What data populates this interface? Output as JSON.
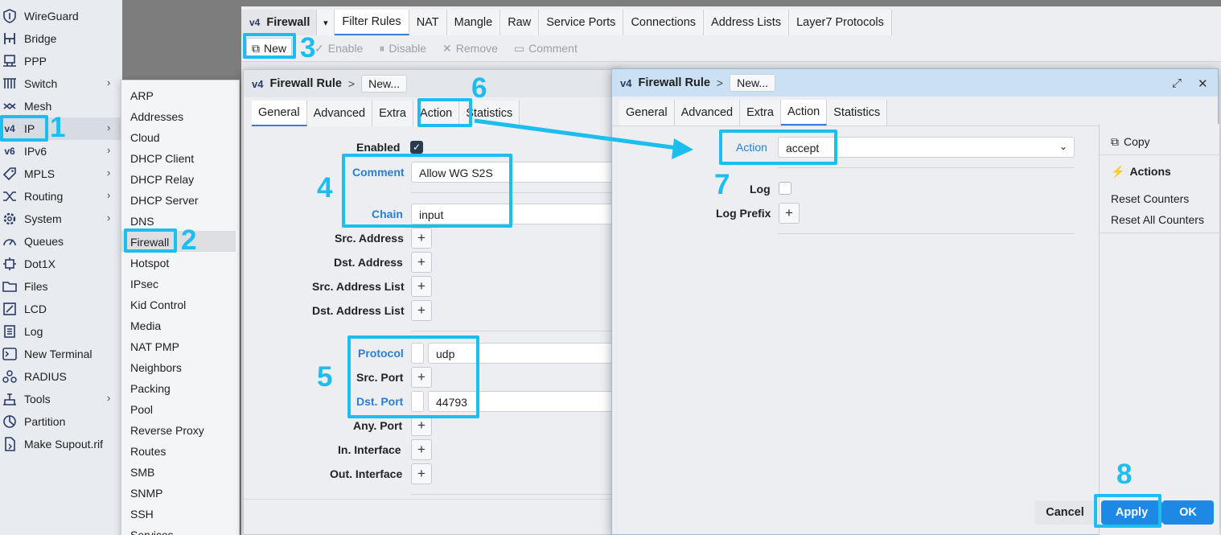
{
  "sidebar": {
    "items": [
      {
        "label": "WireGuard",
        "icon": "shield-icon",
        "chevron": false
      },
      {
        "label": "Bridge",
        "icon": "bridge-icon",
        "chevron": false
      },
      {
        "label": "PPP",
        "icon": "ppp-icon",
        "chevron": false
      },
      {
        "label": "Switch",
        "icon": "switch-icon",
        "chevron": true
      },
      {
        "label": "Mesh",
        "icon": "mesh-icon",
        "chevron": false
      },
      {
        "label": "IP",
        "icon": "ipv4-icon",
        "chevron": true
      },
      {
        "label": "IPv6",
        "icon": "ipv6-icon",
        "chevron": true
      },
      {
        "label": "MPLS",
        "icon": "tag-icon",
        "chevron": true
      },
      {
        "label": "Routing",
        "icon": "routing-icon",
        "chevron": true
      },
      {
        "label": "System",
        "icon": "gear-icon",
        "chevron": true
      },
      {
        "label": "Queues",
        "icon": "gauge-icon",
        "chevron": false
      },
      {
        "label": "Dot1X",
        "icon": "dot1x-icon",
        "chevron": false
      },
      {
        "label": "Files",
        "icon": "folder-icon",
        "chevron": false
      },
      {
        "label": "LCD",
        "icon": "lcd-icon",
        "chevron": false
      },
      {
        "label": "Log",
        "icon": "log-icon",
        "chevron": false
      },
      {
        "label": "New Terminal",
        "icon": "terminal-icon",
        "chevron": false
      },
      {
        "label": "RADIUS",
        "icon": "radius-icon",
        "chevron": false
      },
      {
        "label": "Tools",
        "icon": "tools-icon",
        "chevron": true
      },
      {
        "label": "Partition",
        "icon": "partition-icon",
        "chevron": false
      },
      {
        "label": "Make Supout.rif",
        "icon": "file-icon",
        "chevron": false
      }
    ]
  },
  "submenu": {
    "items": [
      "ARP",
      "Addresses",
      "Cloud",
      "DHCP Client",
      "DHCP Relay",
      "DHCP Server",
      "DNS",
      "Firewall",
      "Hotspot",
      "IPsec",
      "Kid Control",
      "Media",
      "NAT PMP",
      "Neighbors",
      "Packing",
      "Pool",
      "Reverse Proxy",
      "Routes",
      "SMB",
      "SNMP",
      "SSH",
      "Services"
    ]
  },
  "main": {
    "title": "Firewall",
    "title_icon": "v4",
    "tabs": [
      "Filter Rules",
      "NAT",
      "Mangle",
      "Raw",
      "Service Ports",
      "Connections",
      "Address Lists",
      "Layer7 Protocols"
    ],
    "toolbar": {
      "new_label": "New",
      "enable_label": "Enable",
      "disable_label": "Disable",
      "remove_label": "Remove",
      "comment_label": "Comment"
    }
  },
  "dialog_general": {
    "title": "Firewall Rule",
    "breadcrumb_sep": ">",
    "breadcrumb": "New...",
    "tabs": [
      "General",
      "Advanced",
      "Extra",
      "Action",
      "Statistics"
    ],
    "enabled_label": "Enabled",
    "comment_label": "Comment",
    "comment_value": "Allow WG S2S",
    "chain_label": "Chain",
    "chain_value": "input",
    "src_address_label": "Src. Address",
    "dst_address_label": "Dst. Address",
    "src_address_list_label": "Src. Address List",
    "dst_address_list_label": "Dst. Address List",
    "protocol_label": "Protocol",
    "protocol_value": "udp",
    "src_port_label": "Src. Port",
    "dst_port_label": "Dst. Port",
    "dst_port_value": "44793",
    "any_port_label": "Any. Port",
    "in_interface_label": "In. Interface",
    "out_interface_label": "Out. Interface",
    "plus": "+"
  },
  "dialog_action": {
    "title": "Firewall Rule",
    "breadcrumb_sep": ">",
    "breadcrumb": "New...",
    "tabs": [
      "General",
      "Advanced",
      "Extra",
      "Action",
      "Statistics"
    ],
    "action_label": "Action",
    "action_value": "accept",
    "log_label": "Log",
    "log_prefix_label": "Log Prefix",
    "plus": "+",
    "side": {
      "copy_label": "Copy",
      "actions_heading": "Actions",
      "reset_counters": "Reset Counters",
      "reset_all_counters": "Reset All Counters"
    },
    "cancel_label": "Cancel",
    "apply_label": "Apply",
    "ok_label": "OK"
  },
  "annotations": [
    "1",
    "2",
    "3",
    "4",
    "5",
    "6",
    "7",
    "8"
  ],
  "colors": {
    "highlight": "#1dbdf0",
    "link_blue": "#2a7fd4",
    "ok_button": "#1e88e5",
    "title_bar_active": "#cbe0f2"
  }
}
